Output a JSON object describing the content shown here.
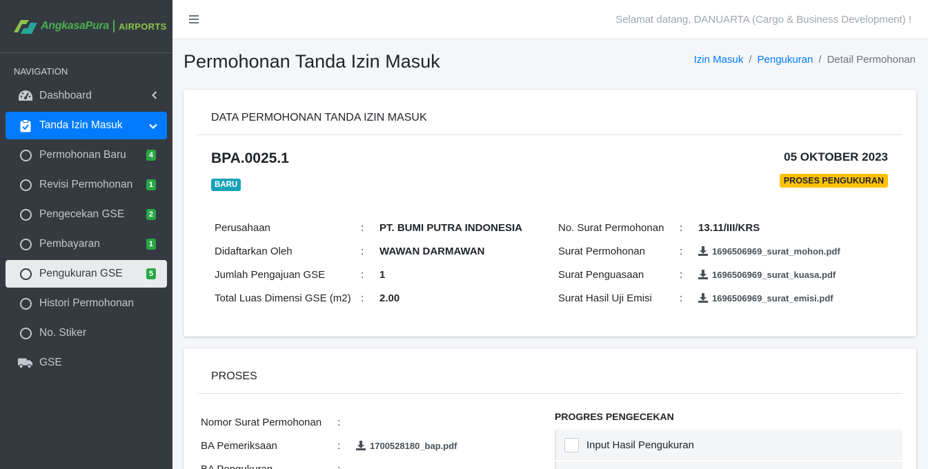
{
  "brand": {
    "name": "AngkasaPura",
    "sub": "AIRPORTS"
  },
  "topbar": {
    "welcome": "Selamat datang, DANUARTA (Cargo & Business Development) !"
  },
  "sidebar": {
    "header": "NAVIGATION",
    "items": [
      {
        "label": "Dashboard",
        "icon": "dashboard-gauge-icon"
      },
      {
        "label": "Tanda Izin Masuk",
        "icon": "clipboard-check-icon",
        "active": true
      },
      {
        "label": "Permohonan Baru",
        "badge": "4"
      },
      {
        "label": "Revisi Permohonan",
        "badge": "1"
      },
      {
        "label": "Pengecekan GSE",
        "badge": "2"
      },
      {
        "label": "Pembayaran",
        "badge": "1"
      },
      {
        "label": "Pengukuran GSE",
        "badge": "5",
        "selected": true
      },
      {
        "label": "Histori Permohonan"
      },
      {
        "label": "No. Stiker"
      },
      {
        "label": "GSE",
        "icon": "truck-icon"
      }
    ]
  },
  "page": {
    "title": "Permohonan Tanda Izin Masuk",
    "breadcrumb": [
      "Izin Masuk",
      "Pengukuran",
      "Detail Permohonan"
    ]
  },
  "detail": {
    "header": "DATA PERMOHONAN TANDA IZIN MASUK",
    "code": "BPA.0025.1",
    "status_badge": "BARU",
    "date": "05 OKTOBER 2023",
    "process_badge": "PROSES PENGUKURAN",
    "left": [
      {
        "label": "Perusahaan",
        "value": "PT. BUMI PUTRA INDONESIA"
      },
      {
        "label": "Didaftarkan Oleh",
        "value": "WAWAN DARMAWAN"
      },
      {
        "label": "Jumlah Pengajuan GSE",
        "value": "1"
      },
      {
        "label": "Total Luas Dimensi GSE (m2)",
        "value": "2.00"
      }
    ],
    "right": [
      {
        "label": "No. Surat Permohonan",
        "value": "13.11/III/KRS"
      },
      {
        "label": "Surat Permohonan",
        "file": "1696506969_surat_mohon.pdf"
      },
      {
        "label": "Surat Penguasaan",
        "file": "1696506969_surat_kuasa.pdf"
      },
      {
        "label": "Surat Hasil Uji Emisi",
        "file": "1696506969_surat_emisi.pdf"
      }
    ],
    "colon": ":"
  },
  "proses": {
    "header": "PROSES",
    "rows": [
      {
        "label": "Nomor Surat Permohonan",
        "value": ""
      },
      {
        "label": "BA Pemeriksaan",
        "file": "1700528180_bap.pdf"
      },
      {
        "label": "BA Pengukuran",
        "value": ""
      }
    ],
    "progress_title": "PROGRES PENGECEKAN",
    "checklist": [
      "Input Hasil Pengukuran",
      ""
    ]
  },
  "colors": {
    "sidebar": "#343a40",
    "active": "#007bff",
    "badge_green": "#28a745",
    "badge_info": "#17a2b8",
    "badge_warning": "#ffc107"
  }
}
